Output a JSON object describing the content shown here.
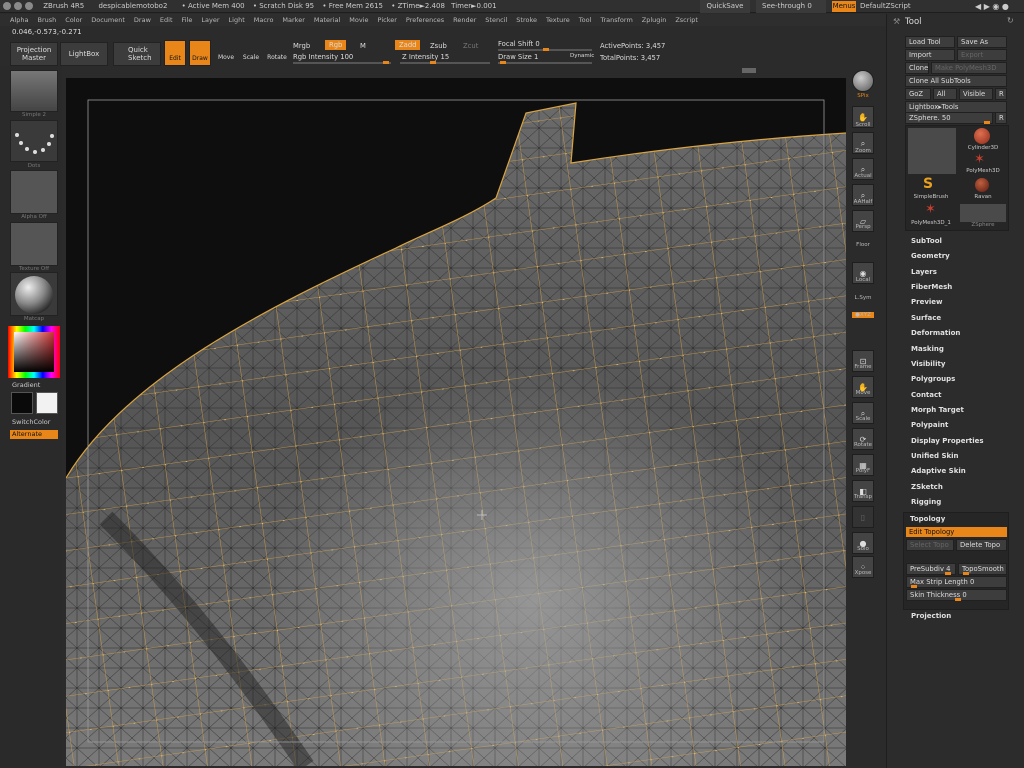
{
  "title_bar": {
    "app": "ZBrush 4R5",
    "doc": "despicablemotobo2",
    "active_mem": "• Active Mem 400",
    "scratch_disk": "• Scratch Disk 95",
    "free_mem": "• Free Mem 2615",
    "ztime": "• ZTime►2.408",
    "timer": "Timer►0.001",
    "quicksave": "QuickSave",
    "see_through": "See-through",
    "see_through_value": "0",
    "menus": "Menus",
    "script": "DefaultZScript"
  },
  "menubar": [
    "Alpha",
    "Brush",
    "Color",
    "Document",
    "Draw",
    "Edit",
    "File",
    "Layer",
    "Light",
    "Macro",
    "Marker",
    "Material",
    "Movie",
    "Picker",
    "Preferences",
    "Render",
    "Stencil",
    "Stroke",
    "Texture",
    "Tool",
    "Transform",
    "Zplugin",
    "Zscript"
  ],
  "coords": "0.046,-0.573,-0.271",
  "toolbar": {
    "projection_master": "Projection Master",
    "lightbox": "LightBox",
    "quick_sketch": "Quick Sketch",
    "edit": "Edit",
    "draw": "Draw",
    "move": "Move",
    "scale": "Scale",
    "rotate": "Rotate",
    "mrgb": "Mrgb",
    "rgb": "Rgb",
    "m": "M",
    "rgb_intensity": "Rgb Intensity 100",
    "zadd": "Zadd",
    "zsub": "Zsub",
    "zcut": "Zcut",
    "z_intensity": "Z Intensity 15",
    "focal_shift": "Focal Shift 0",
    "draw_size": "Draw Size 1",
    "dynamic": "Dynamic",
    "active_points": "ActivePoints: 3,457",
    "total_points": "TotalPoints: 3,457"
  },
  "left_panel": {
    "brush_lbl": "Simple 2",
    "stroke_lbl": "Dots",
    "alpha_lbl": "Alpha Off",
    "texture_lbl": "Texture Off",
    "material_lbl": "Matcap",
    "gradient": "Gradient",
    "switchcolor": "SwitchColor",
    "alternate": "Alternate"
  },
  "right_tools": {
    "spix": "SPix",
    "scroll": "Scroll",
    "zoom": "Zoom",
    "actual": "Actual",
    "aahalf": "AAHalf",
    "persp": "Persp",
    "floor": "Floor",
    "local": "Local",
    "lsym": "L.Sym",
    "xyz": "●XYZ",
    "frame": "Frame",
    "move": "Move",
    "scale": "Scale",
    "rotate": "Rotate",
    "polyf": "PolyF",
    "transp": "Transp",
    "solo": "Solo",
    "xpose": "Xpose"
  },
  "tool_panel": {
    "title": "Tool",
    "load_tool": "Load Tool",
    "save_as": "Save As",
    "import": "Import",
    "export": "Export",
    "clone": "Clone",
    "make_polymesh": "Make PolyMesh3D",
    "clone_all_subtools": "Clone All SubTools",
    "goz": "GoZ",
    "all": "All",
    "visible": "Visible",
    "r": "R",
    "lightbox_tools": "Lightbox▸Tools",
    "zsphere_slider": "ZSphere. 50",
    "tools": [
      "Cylinder3D",
      "PolyMesh3D",
      "SimpleBrush",
      "Ravan",
      "PolyMesh3D_1",
      "ZSphere"
    ],
    "sections": [
      "SubTool",
      "Geometry",
      "Layers",
      "FiberMesh",
      "Preview",
      "Surface",
      "Deformation",
      "Masking",
      "Visibility",
      "Polygroups",
      "Contact",
      "Morph Target",
      "Polypaint",
      "Display Properties",
      "Unified Skin",
      "Adaptive Skin",
      "ZSketch",
      "Rigging"
    ],
    "topology": "Topology",
    "edit_topology": "Edit Topology",
    "select_topo": "Select Topo",
    "delete_topo": "Delete Topo",
    "presubdiv": "PreSubdiv 4",
    "toposmooth": "TopoSmooth",
    "max_strip_length": "Max Strip Length 0",
    "skin_thickness": "Skin Thickness 0",
    "projection": "Projection"
  },
  "colors": {
    "accent": "#e8861a",
    "wire": "#d9a441"
  }
}
